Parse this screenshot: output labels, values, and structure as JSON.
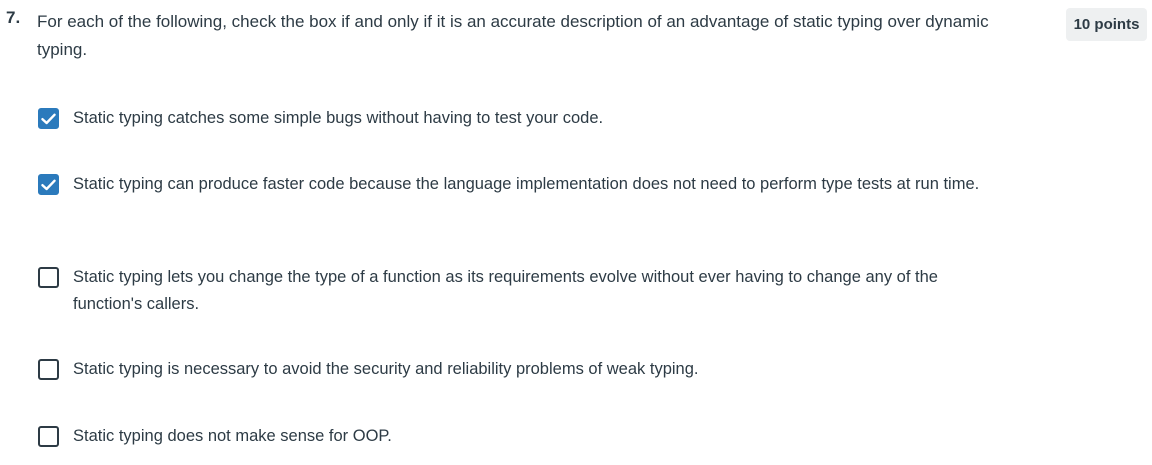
{
  "question": {
    "number": "7.",
    "text": "For each of the following, check the box if and only if it is an accurate description of an advantage of static typing over dynamic typing.",
    "points": "10 points"
  },
  "options": [
    {
      "label": "Static typing catches some simple bugs without having to test your code.",
      "checked": true
    },
    {
      "label": "Static typing can produce faster code because the language implementation does not need to perform type tests at run time.",
      "checked": true
    },
    {
      "label": "Static typing lets you change the type of a function as its requirements evolve without ever having to change any of the function's callers.",
      "checked": false
    },
    {
      "label": "Static typing is necessary to avoid the security and reliability problems of weak typing.",
      "checked": false
    },
    {
      "label": "Static typing does not make sense for OOP.",
      "checked": false
    }
  ],
  "colors": {
    "checked": "#2b7abc",
    "text": "#2d3b45",
    "badge_bg": "#eef0f1"
  }
}
